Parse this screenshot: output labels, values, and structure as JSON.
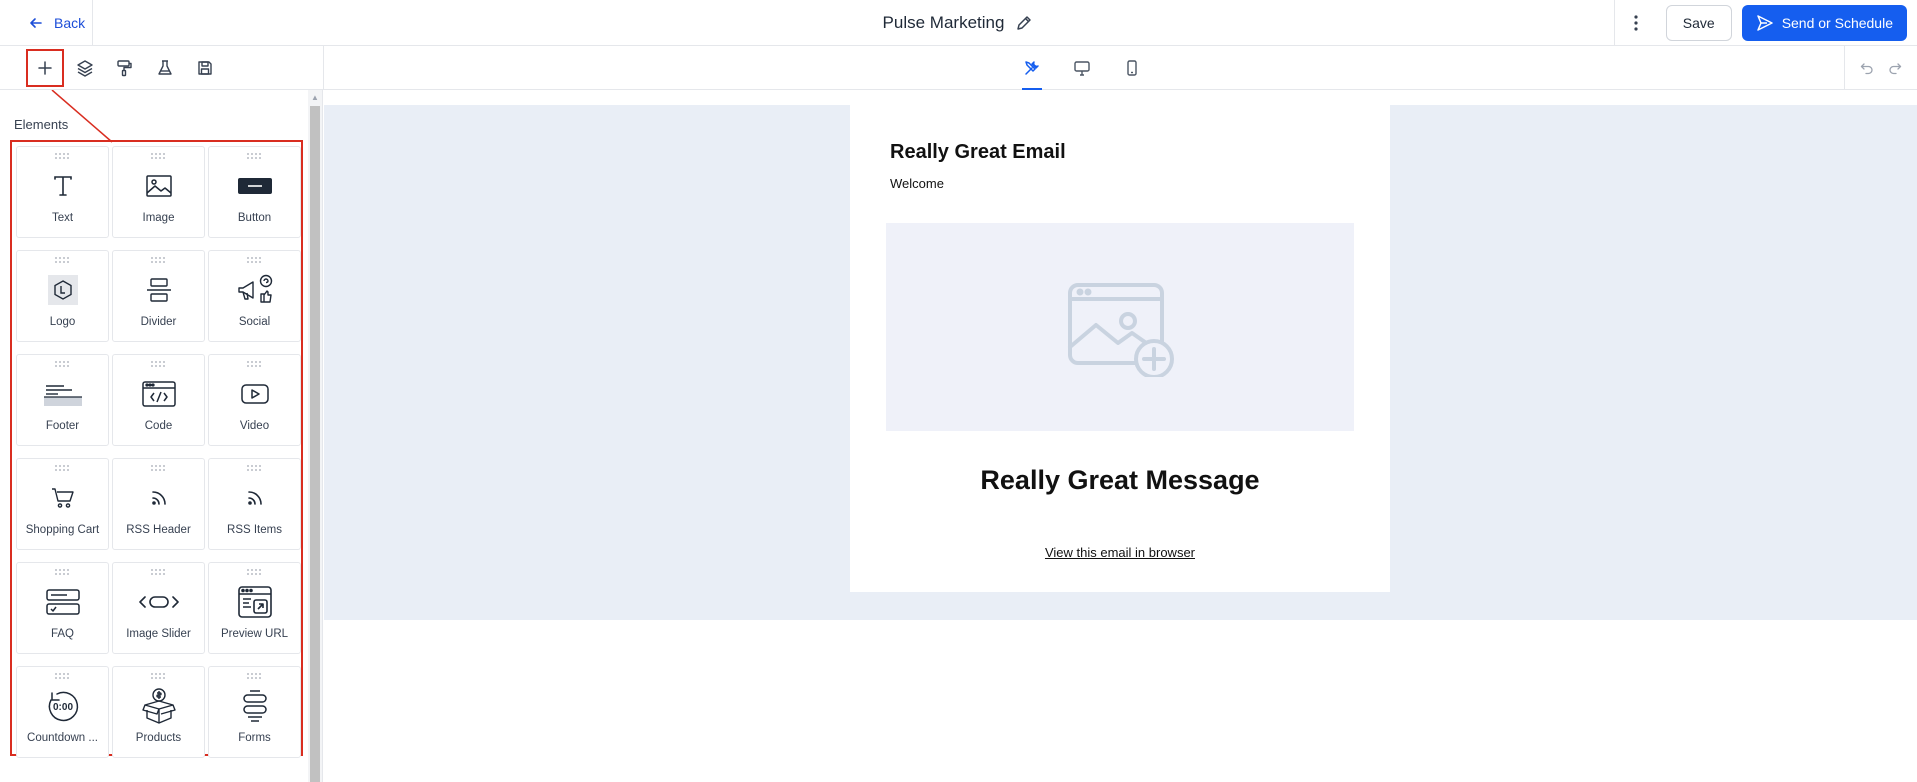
{
  "header": {
    "back_label": "Back",
    "title": "Pulse Marketing",
    "save_label": "Save",
    "send_label": "Send or Schedule"
  },
  "sidebar": {
    "section_label": "Elements",
    "elements": [
      {
        "label": "Text",
        "icon": "text-icon"
      },
      {
        "label": "Image",
        "icon": "image-icon"
      },
      {
        "label": "Button",
        "icon": "button-icon"
      },
      {
        "label": "Logo",
        "icon": "logo-icon"
      },
      {
        "label": "Divider",
        "icon": "divider-icon"
      },
      {
        "label": "Social",
        "icon": "social-icon"
      },
      {
        "label": "Footer",
        "icon": "footer-icon"
      },
      {
        "label": "Code",
        "icon": "code-icon"
      },
      {
        "label": "Video",
        "icon": "video-icon"
      },
      {
        "label": "Shopping Cart",
        "icon": "shopping-cart-icon"
      },
      {
        "label": "RSS Header",
        "icon": "rss-icon"
      },
      {
        "label": "RSS Items",
        "icon": "rss-icon"
      },
      {
        "label": "FAQ",
        "icon": "faq-icon"
      },
      {
        "label": "Image Slider",
        "icon": "image-slider-icon"
      },
      {
        "label": "Preview URL",
        "icon": "preview-url-icon"
      },
      {
        "label": "Countdown ...",
        "icon": "countdown-icon"
      },
      {
        "label": "Products",
        "icon": "products-icon"
      },
      {
        "label": "Forms",
        "icon": "forms-icon"
      }
    ]
  },
  "email": {
    "heading": "Really Great Email",
    "welcome": "Welcome",
    "message": "Really Great Message",
    "view_link": "View this email in browser"
  },
  "colors": {
    "accent": "#155eef",
    "highlight": "#d92d20",
    "canvas_bg": "#e9eef6"
  }
}
